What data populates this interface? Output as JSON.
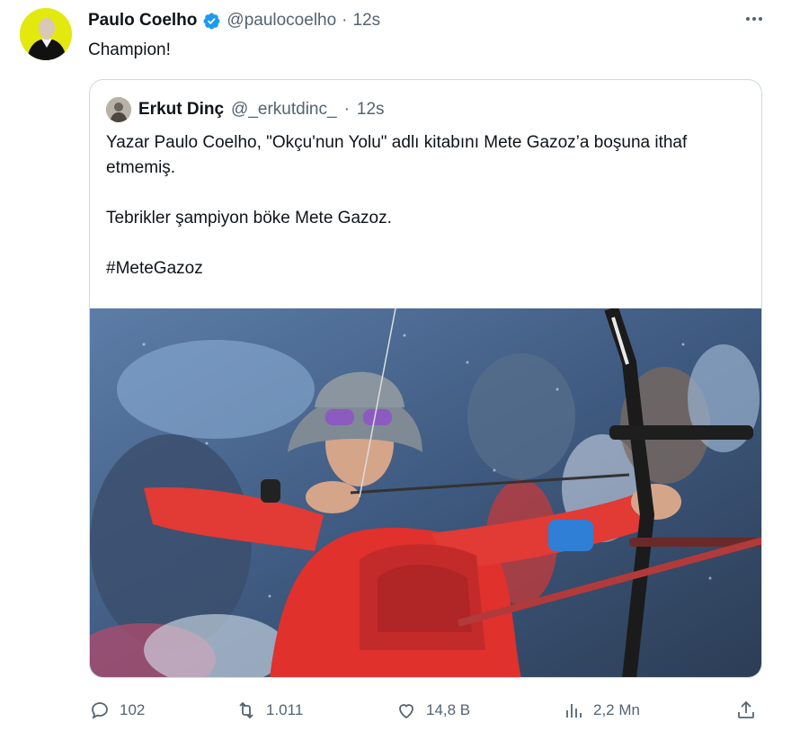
{
  "tweet": {
    "author_name": "Paulo Coelho",
    "author_handle": "@paulocoelho",
    "separator": "·",
    "time": "12s",
    "text": "Champion!",
    "more_icon": "more-icon",
    "verified_color": "#1d9bf0"
  },
  "quote": {
    "author_name": "Erkut Dinç",
    "author_handle": "@_erkutdinc_",
    "separator": "·",
    "time": "12s",
    "paragraph1": "Yazar Paulo Coelho, \"Okçu'nun Yolu\" adlı kitabını Mete Gazoz’a boşuna ithaf etmemiş.",
    "paragraph2": "Tebrikler şampiyon böke Mete Gazoz.",
    "paragraph3": "#MeteGazoz",
    "media_icon": "archer-photo"
  },
  "actions": {
    "replies": "102",
    "retweets": "1.011",
    "likes": "14,8 B",
    "views": "2,2 Mn",
    "icons": [
      "reply-icon",
      "retweet-icon",
      "like-icon",
      "views-icon",
      "share-icon"
    ]
  },
  "colors": {
    "text": "#0f1419",
    "muted": "#536471",
    "border": "#cfd9de",
    "accent": "#1d9bf0"
  }
}
